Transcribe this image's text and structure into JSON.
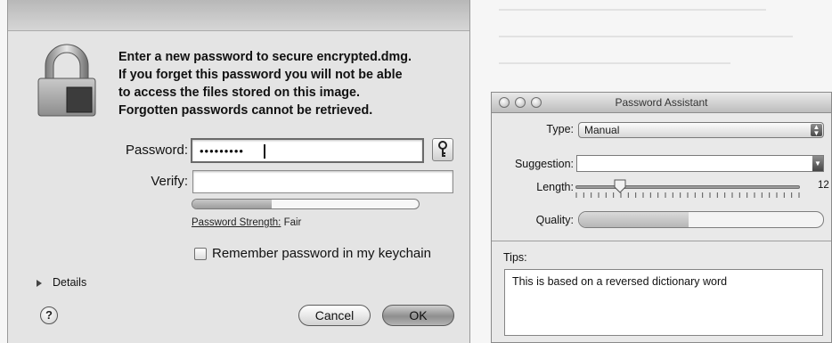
{
  "password_sheet": {
    "message_lines": [
      "Enter a new password to secure encrypted.dmg.",
      "If you forget this password you will not be able",
      "to access the files stored on this image.",
      "Forgotten passwords cannot be retrieved."
    ],
    "password_label": "Password:",
    "password_value": "•••••••••",
    "key_button_glyph": "🔑",
    "verify_label": "Verify:",
    "strength_label": "Password Strength:",
    "strength_value": "Fair",
    "strength_level": 0.35,
    "remember_label": "Remember password in my keychain",
    "details_label": "Details",
    "help_label": "?",
    "cancel_label": "Cancel",
    "ok_label": "OK"
  },
  "assistant": {
    "title": "Password Assistant",
    "type_label": "Type:",
    "type_value": "Manual",
    "suggestion_label": "Suggestion:",
    "suggestion_value": "",
    "length_label": "Length:",
    "length_value": "12",
    "length_level": 0.2,
    "quality_label": "Quality:",
    "quality_level": 0.45,
    "tips_label": "Tips:",
    "tips_text": "This is based on a reversed dictionary word"
  },
  "colors": {
    "sheet_bg": "#e4e4e4",
    "window_bg": "#e9e9e9"
  }
}
